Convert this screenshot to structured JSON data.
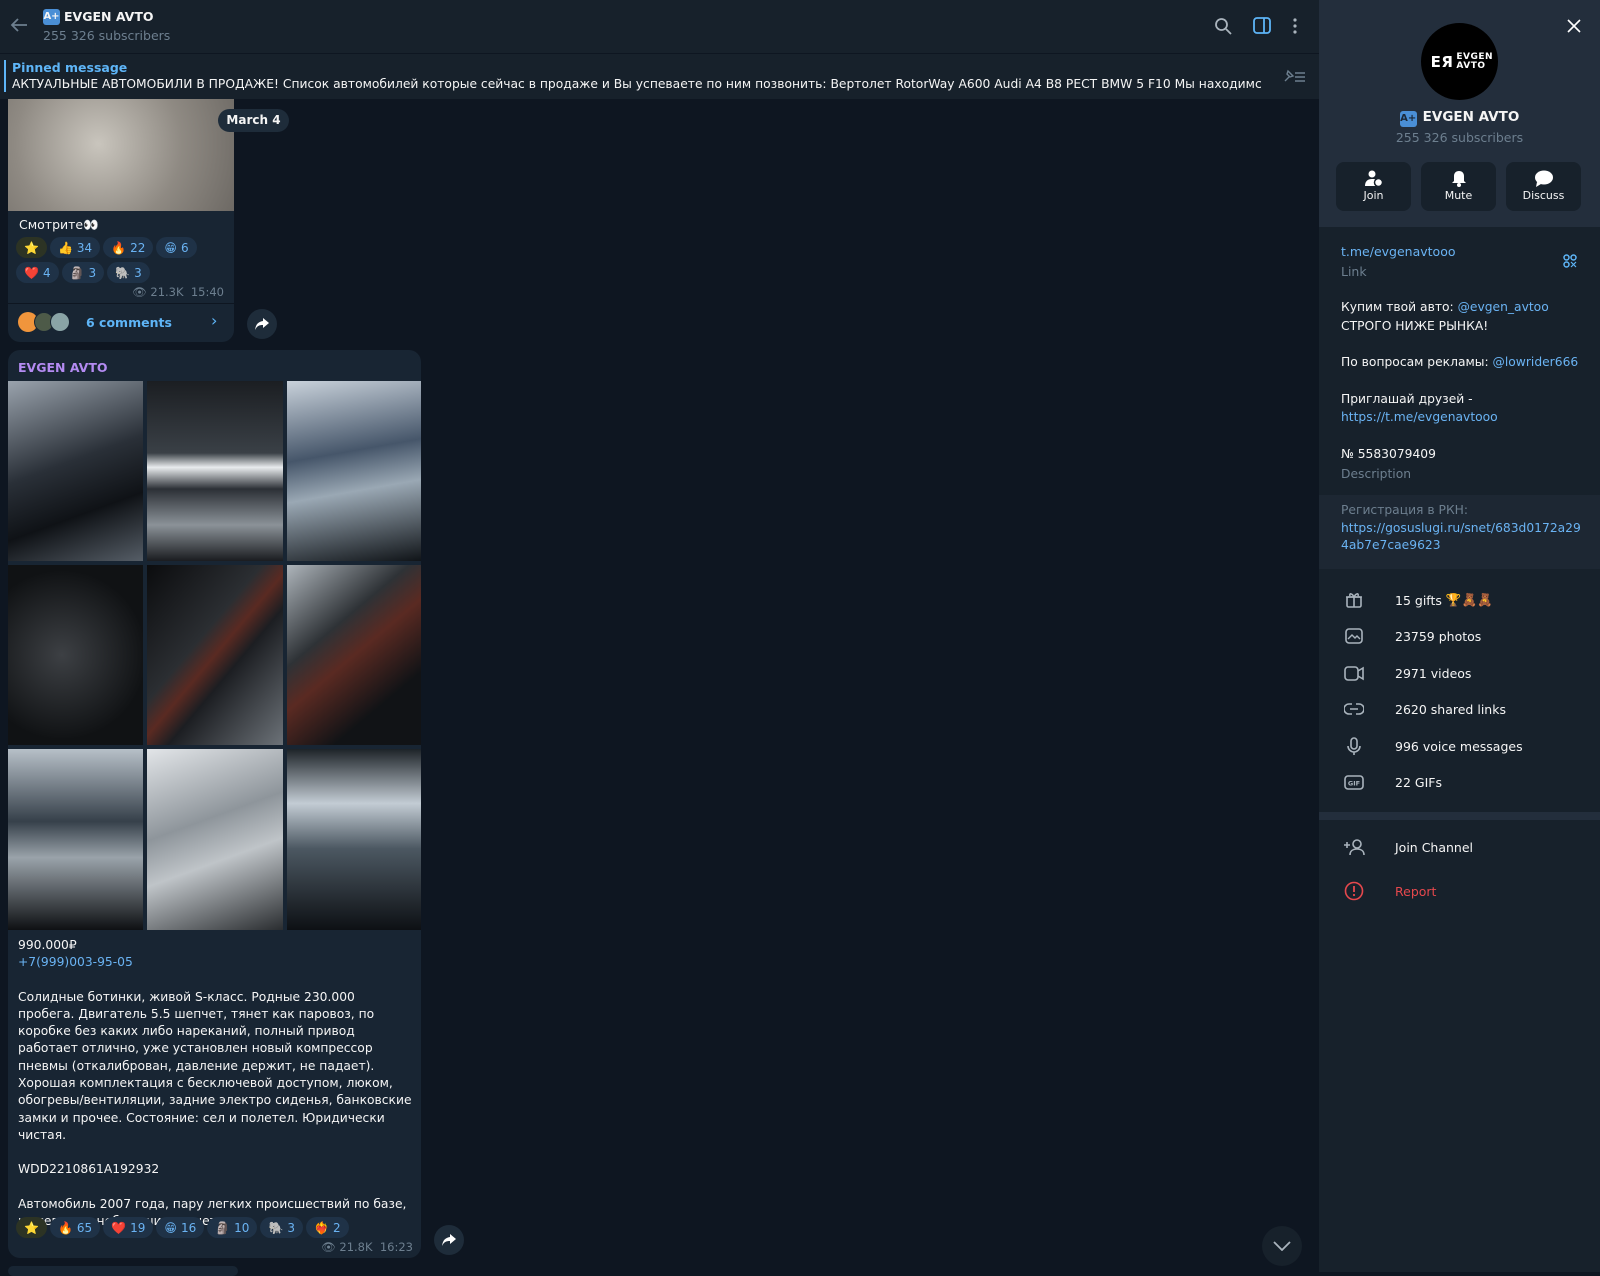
{
  "header": {
    "title": "EVGEN AVTO",
    "subtitle": "255 326 subscribers"
  },
  "pinned": {
    "label": "Pinned message",
    "text": "АКТУАЛЬНЫЕ АВТОМОБИЛИ В ПРОДАЖЕ!  Список автомобилей которые сейчас в продаже и Вы успеваете по ним позвонить:  Вертолет RotorWay A600  Audi A4 B8 РЕСТ  BMW 5 F10  Мы находимся в городе М..."
  },
  "date_pill": "March 4",
  "message1": {
    "caption": "Смотрите👀",
    "reactions": [
      {
        "emoji": "👍",
        "count": "34"
      },
      {
        "emoji": "🔥",
        "count": "22"
      },
      {
        "emoji": "😁",
        "count": "6"
      },
      {
        "emoji": "❤️",
        "count": "4"
      },
      {
        "emoji": "🗿",
        "count": "3"
      },
      {
        "emoji": "🐘",
        "count": "3"
      }
    ],
    "star": "⭐",
    "views": "21.3K",
    "time": "15:40",
    "comments": "6 comments"
  },
  "message2": {
    "author": "EVGEN AVTO",
    "price": "990.000₽",
    "phone": "+7(999)003-95-05",
    "body": "Солидные ботинки, живой S-класс. Родные 230.000 пробега. Двигатель 5.5 шепчет, тянет как паровоз, по коробке без каких либо нареканий, полный привод работает отлично, уже установлен новый компрессор пневмы (откалиброван, давление держит, не падает). Хорошая комплектация с бесключевой доступом, люком, обогревы/вентиляции, задние электро сиденья, банковские замки и прочее. Состояние: сел и полетел. Юридически чистая.",
    "vin": "WDD2210861A192932",
    "footer": "Автомобиль 2007 года, пару легких происшествий по базе, и всего два небольших расчета.",
    "star": "⭐",
    "reactions": [
      {
        "emoji": "🔥",
        "count": "65"
      },
      {
        "emoji": "❤️",
        "count": "19"
      },
      {
        "emoji": "😁",
        "count": "16"
      },
      {
        "emoji": "🗿",
        "count": "10"
      },
      {
        "emoji": "🐘",
        "count": "3"
      },
      {
        "emoji": "❤️‍🔥",
        "count": "2"
      }
    ],
    "views": "21.8K",
    "time": "16:23"
  },
  "panel": {
    "avatar_text": "EVGEN AVTO",
    "title": "EVGEN AVTO",
    "subtitle": "255 326 subscribers",
    "buttons": {
      "join": "Join",
      "mute": "Mute",
      "discuss": "Discuss"
    },
    "link": "t.me/evgenavtooo",
    "link_label": "Link",
    "desc_1a": "Купим твой авто: ",
    "desc_1b": "@evgen_avtoo",
    "desc_2": "СТРОГО НИЖЕ РЫНКА!",
    "desc_3a": "По вопросам рекламы: ",
    "desc_3b": "@lowrider666",
    "desc_4": "Приглашай друзей -",
    "desc_5": "https://t.me/evgenavtooo",
    "desc_6": "№ 5583079409",
    "desc_label": "Description",
    "rkn_label": "Регистрация в РКН:",
    "rkn_link": "https://gosuslugi.ru/snet/683d0172a294ab7e7cae9623",
    "stats": {
      "gifts": "15 gifts",
      "gift_emoji": "🏆🧸🧸",
      "photos": "23759 photos",
      "videos": "2971 videos",
      "links": "2620 shared links",
      "voice": "996 voice messages",
      "gifs": "22 GIFs"
    },
    "join_channel": "Join Channel",
    "report": "Report"
  },
  "colors": {
    "accent": "#5eb5f7",
    "report": "#e5484d",
    "chat_bg": "#0e1621",
    "panel_bg": "#17212b"
  }
}
